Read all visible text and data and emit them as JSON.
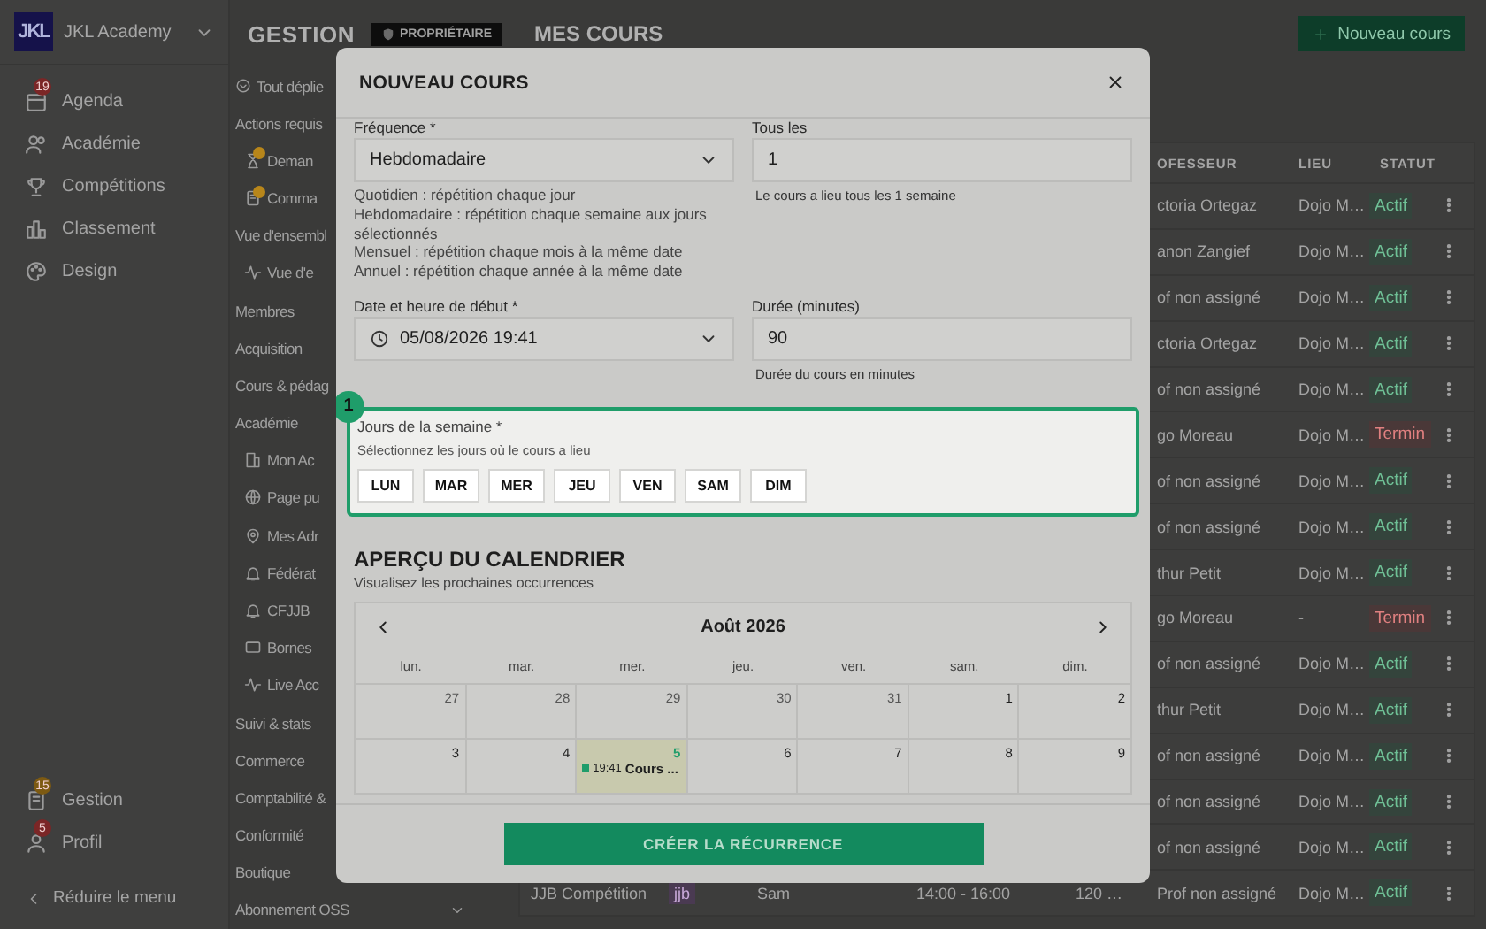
{
  "sidebar": {
    "brand": {
      "logo": "JKL",
      "name": "JKL Academy"
    },
    "items": [
      {
        "label": "Agenda",
        "badge": {
          "text": "19",
          "color": "#7b2626"
        }
      },
      {
        "label": "Académie"
      },
      {
        "label": "Compétitions"
      },
      {
        "label": "Classement"
      },
      {
        "label": "Design"
      }
    ],
    "bottom_items": [
      {
        "label": "Gestion",
        "badge": {
          "text": "15",
          "color": "#7d5a12"
        }
      },
      {
        "label": "Profil",
        "badge": {
          "text": "5",
          "color": "#7b2626"
        }
      }
    ],
    "collapse": "Réduire le menu"
  },
  "topbar": {
    "section": "GESTION",
    "role_badge": "PROPRIÉTAIRE",
    "page_title": "MES COURS",
    "new_button": "Nouveau cours"
  },
  "subnav": {
    "expand_all": "Tout déplie",
    "items": [
      {
        "kind": "section",
        "label": "Actions requis"
      },
      {
        "kind": "link",
        "label": "Deman",
        "badge": true
      },
      {
        "kind": "link",
        "label": "Comma",
        "badge": true
      },
      {
        "kind": "section",
        "label": "Vue d'ensembl"
      },
      {
        "kind": "link",
        "label": "Vue d'e",
        "badge": false
      },
      {
        "kind": "section",
        "label": "Membres"
      },
      {
        "kind": "section",
        "label": "Acquisition"
      },
      {
        "kind": "section",
        "label": "Cours & pédag"
      },
      {
        "kind": "section",
        "label": "Académie"
      },
      {
        "kind": "link",
        "label": "Mon Ac",
        "badge": false
      },
      {
        "kind": "link",
        "label": "Page pu",
        "badge": false
      },
      {
        "kind": "link",
        "label": "Mes Adr",
        "badge": false
      },
      {
        "kind": "link",
        "label": "Fédérat",
        "badge": false
      },
      {
        "kind": "link",
        "label": "CFJJB",
        "badge": false
      },
      {
        "kind": "link",
        "label": "Bornes",
        "badge": false
      },
      {
        "kind": "link",
        "label": "Live Acc",
        "badge": false
      },
      {
        "kind": "section",
        "label": "Suivi & stats"
      },
      {
        "kind": "section",
        "label": "Commerce"
      },
      {
        "kind": "section",
        "label": "Comptabilité &"
      },
      {
        "kind": "section",
        "label": "Conformité"
      },
      {
        "kind": "section",
        "label": "Boutique"
      },
      {
        "kind": "collapsible",
        "label": "Abonnement OSS"
      }
    ]
  },
  "table": {
    "columns": [
      "OFESSEUR",
      "LIEU",
      "STATUT"
    ],
    "rows": [
      {
        "professeur": "ctoria Ortegaz",
        "lieu": "Dojo M…",
        "statut": "Actif",
        "kind": "active"
      },
      {
        "professeur": "anon Zangief",
        "lieu": "Dojo M…",
        "statut": "Actif",
        "kind": "active"
      },
      {
        "professeur": "of non assigné",
        "lieu": "Dojo M…",
        "statut": "Actif",
        "kind": "active"
      },
      {
        "professeur": "ctoria Ortegaz",
        "lieu": "Dojo M…",
        "statut": "Actif",
        "kind": "active"
      },
      {
        "professeur": "of non assigné",
        "lieu": "Dojo M…",
        "statut": "Actif",
        "kind": "active"
      },
      {
        "professeur": "go Moreau",
        "lieu": "Dojo M…",
        "statut": "Termin",
        "kind": "ended"
      },
      {
        "professeur": "of non assigné",
        "lieu": "Dojo M…",
        "statut": "Actif",
        "kind": "active"
      },
      {
        "professeur": "of non assigné",
        "lieu": "Dojo M…",
        "statut": "Actif",
        "kind": "active"
      },
      {
        "professeur": "thur Petit",
        "lieu": "Dojo M…",
        "statut": "Actif",
        "kind": "active"
      },
      {
        "professeur": "go Moreau",
        "lieu": "-",
        "statut": "Termin",
        "kind": "ended"
      },
      {
        "professeur": "of non assigné",
        "lieu": "Dojo M…",
        "statut": "Actif",
        "kind": "active"
      },
      {
        "professeur": "thur Petit",
        "lieu": "Dojo M…",
        "statut": "Actif",
        "kind": "active"
      },
      {
        "professeur": "of non assigné",
        "lieu": "Dojo M…",
        "statut": "Actif",
        "kind": "active"
      },
      {
        "professeur": "of non assigné",
        "lieu": "Dojo M…",
        "statut": "Actif",
        "kind": "active"
      },
      {
        "professeur": "of non assigné",
        "lieu": "Dojo M…",
        "statut": "Actif",
        "kind": "active"
      },
      {
        "name": "JJB Compétition",
        "tag": "jjb",
        "day": "Sam",
        "time": "14:00 - 16:00",
        "duration": "120 …",
        "professeur": "Prof non assigné",
        "lieu": "Dojo M…",
        "statut": "Actif",
        "kind": "active"
      }
    ]
  },
  "modal": {
    "title": "NOUVEAU COURS",
    "frequency": {
      "label": "Fréquence *",
      "value": "Hebdomadaire",
      "help": [
        "Quotidien : répétition chaque jour",
        "Hebdomadaire : répétition chaque semaine aux jours sélectionnés",
        "Mensuel : répétition chaque mois à la même date",
        "Annuel : répétition chaque année à la même date"
      ]
    },
    "interval": {
      "label": "Tous les",
      "value": "1",
      "hint": "Le cours a lieu tous les 1 semaine"
    },
    "start": {
      "label": "Date et heure de début *",
      "value": "05/08/2026 19:41"
    },
    "duration": {
      "label": "Durée (minutes)",
      "value": "90",
      "hint": "Durée du cours en minutes"
    },
    "weekdays": {
      "step": "1",
      "label": "Jours de la semaine *",
      "hint": "Sélectionnez les jours où le cours a lieu",
      "days": [
        {
          "label": "LUN",
          "selected": false
        },
        {
          "label": "MAR",
          "selected": false
        },
        {
          "label": "MER",
          "selected": false
        },
        {
          "label": "JEU",
          "selected": false
        },
        {
          "label": "VEN",
          "selected": false
        },
        {
          "label": "SAM",
          "selected": false
        },
        {
          "label": "DIM",
          "selected": false
        }
      ]
    },
    "preview": {
      "title": "APERÇU DU CALENDRIER",
      "subtitle": "Visualisez les prochaines occurrences",
      "month": "Août 2026",
      "weekday_names": [
        "lun.",
        "mar.",
        "mer.",
        "jeu.",
        "ven.",
        "sam.",
        "dim."
      ],
      "weeks": [
        [
          {
            "n": "27",
            "muted": true
          },
          {
            "n": "28",
            "muted": true
          },
          {
            "n": "29",
            "muted": true
          },
          {
            "n": "30",
            "muted": true
          },
          {
            "n": "31",
            "muted": true
          },
          {
            "n": "1",
            "muted": false
          },
          {
            "n": "2",
            "muted": false
          }
        ],
        [
          {
            "n": "3",
            "muted": false
          },
          {
            "n": "4",
            "muted": false
          },
          {
            "n": "5",
            "muted": false,
            "today": true,
            "events": [
              {
                "time": "19:41",
                "title": "Cours ..."
              }
            ]
          },
          {
            "n": "6",
            "muted": false
          },
          {
            "n": "7",
            "muted": false
          },
          {
            "n": "8",
            "muted": false
          },
          {
            "n": "9",
            "muted": false
          }
        ]
      ]
    },
    "submit": "CRÉER LA RÉCURRENCE"
  }
}
